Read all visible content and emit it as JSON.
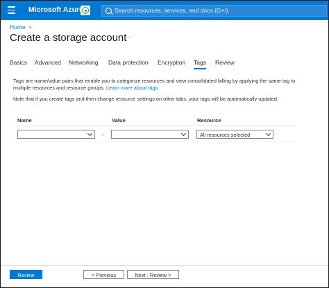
{
  "topbar": {
    "brand": "Microsoft Azure",
    "search_placeholder": "Search resources, services, and docs (G+/)"
  },
  "breadcrumb": {
    "home": "Home",
    "separator": ">"
  },
  "page": {
    "title": "Create a storage account",
    "more": "..."
  },
  "tabs": [
    {
      "label": "Basics",
      "active": false
    },
    {
      "label": "Advanced",
      "active": false
    },
    {
      "label": "Networking",
      "active": false
    },
    {
      "label": "Data protection",
      "active": false
    },
    {
      "label": "Encryption",
      "active": false
    },
    {
      "label": "Tags",
      "active": true
    },
    {
      "label": "Review",
      "active": false
    }
  ],
  "description": {
    "text": "Tags are name/value pairs that enable you to categorize resources and view consolidated billing by applying the same tag to multiple resources and resource groups.",
    "link": "Learn more about tags",
    "note": "Note that if you create tags and then change resource settings on other tabs, your tags will be automatically updated."
  },
  "table": {
    "headers": {
      "name": "Name",
      "value": "Value",
      "resource": "Resource"
    },
    "row": {
      "name": "",
      "value": "",
      "separator": ":",
      "resource": "All resources selected"
    }
  },
  "footer": {
    "review": "Review",
    "previous": "< Previous",
    "next": "Next : Review >"
  },
  "colors": {
    "accent": "#0078d4",
    "text": "#323130",
    "border": "#8a8886"
  },
  "icons": {
    "menu": "hamburger-menu-icon",
    "cloud_shell": "cloud-shell-icon",
    "search": "search-icon",
    "dropdown": "chevron-down-icon"
  }
}
